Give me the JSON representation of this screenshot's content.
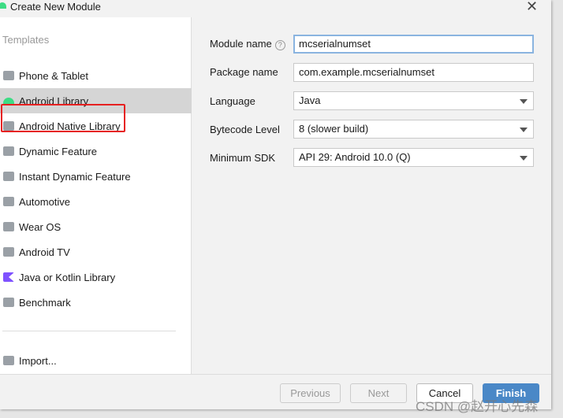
{
  "window": {
    "title": "Create New Module",
    "close": "✕"
  },
  "sidebar": {
    "heading": "Templates",
    "items": [
      {
        "label": "Phone & Tablet",
        "icon": "phone-tablet-icon"
      },
      {
        "label": "Android Library",
        "icon": "android-icon",
        "selected": true
      },
      {
        "label": "Android Native Library",
        "icon": "native-library-icon"
      },
      {
        "label": "Dynamic Feature",
        "icon": "dynamic-feature-icon"
      },
      {
        "label": "Instant Dynamic Feature",
        "icon": "instant-feature-icon"
      },
      {
        "label": "Automotive",
        "icon": "car-icon"
      },
      {
        "label": "Wear OS",
        "icon": "watch-icon"
      },
      {
        "label": "Android TV",
        "icon": "tv-icon"
      },
      {
        "label": "Java or Kotlin Library",
        "icon": "kotlin-icon"
      },
      {
        "label": "Benchmark",
        "icon": "gauge-icon"
      }
    ],
    "import": "Import..."
  },
  "form": {
    "module_name": {
      "label": "Module name",
      "value": "mcserialnumset"
    },
    "package_name": {
      "label": "Package name",
      "value": "com.example.mcserialnumset"
    },
    "language": {
      "label": "Language",
      "value": "Java"
    },
    "bytecode": {
      "label": "Bytecode Level",
      "value": "8 (slower build)"
    },
    "min_sdk": {
      "label": "Minimum SDK",
      "value": "API 29: Android 10.0 (Q)"
    }
  },
  "footer": {
    "previous": "Previous",
    "next": "Next",
    "cancel": "Cancel",
    "finish": "Finish"
  },
  "watermark": "CSDN @赵开心先森",
  "colors": {
    "accent": "#4a88c7",
    "highlight": "#e62020",
    "android": "#3ddc84"
  }
}
